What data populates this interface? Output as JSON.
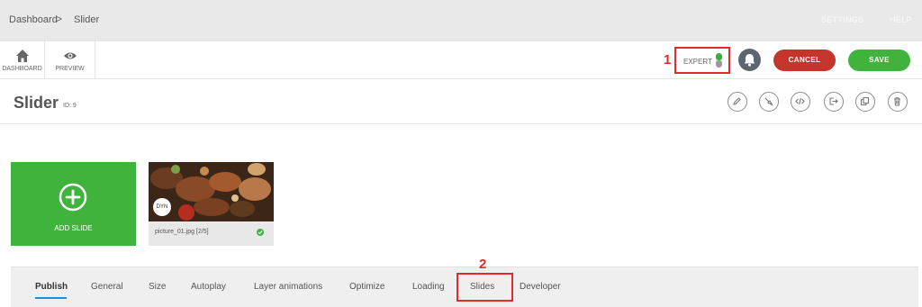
{
  "breadcrumb": {
    "home": "Dashboard",
    "separator": ">",
    "current": "Slider"
  },
  "top_links": {
    "settings": "SETTINGS",
    "help": "HELP"
  },
  "toolbar": {
    "dashboard_label": "DASHBOARD",
    "preview_label": "PREVIEW",
    "expert_label": "EXPERT",
    "expert_enabled": true,
    "cancel_label": "CANCEL",
    "save_label": "SAVE"
  },
  "annotations": {
    "expert": "1",
    "slides_tab": "2",
    "color": "#e32b2b"
  },
  "page": {
    "title": "Slider",
    "id_label": "ID: 9",
    "actions": [
      "pencil-icon",
      "brush-icon",
      "code-icon",
      "export-icon",
      "duplicate-icon",
      "trash-icon"
    ]
  },
  "slides": {
    "add_label": "ADD SLIDE",
    "items": [
      {
        "badge": "DYN",
        "label": "picture_01.jpg [2/5]",
        "published": true
      }
    ]
  },
  "tabs": [
    {
      "label": "Publish",
      "active": true
    },
    {
      "label": "General"
    },
    {
      "label": "Size"
    },
    {
      "label": "Autoplay"
    },
    {
      "label": "Layer animations"
    },
    {
      "label": "Optimize"
    },
    {
      "label": "Loading"
    },
    {
      "label": "Slides"
    },
    {
      "label": "Developer"
    }
  ],
  "colors": {
    "accent_green": "#3fb33c",
    "cancel_red": "#c6352c",
    "tab_underline": "#1c8fd6"
  }
}
